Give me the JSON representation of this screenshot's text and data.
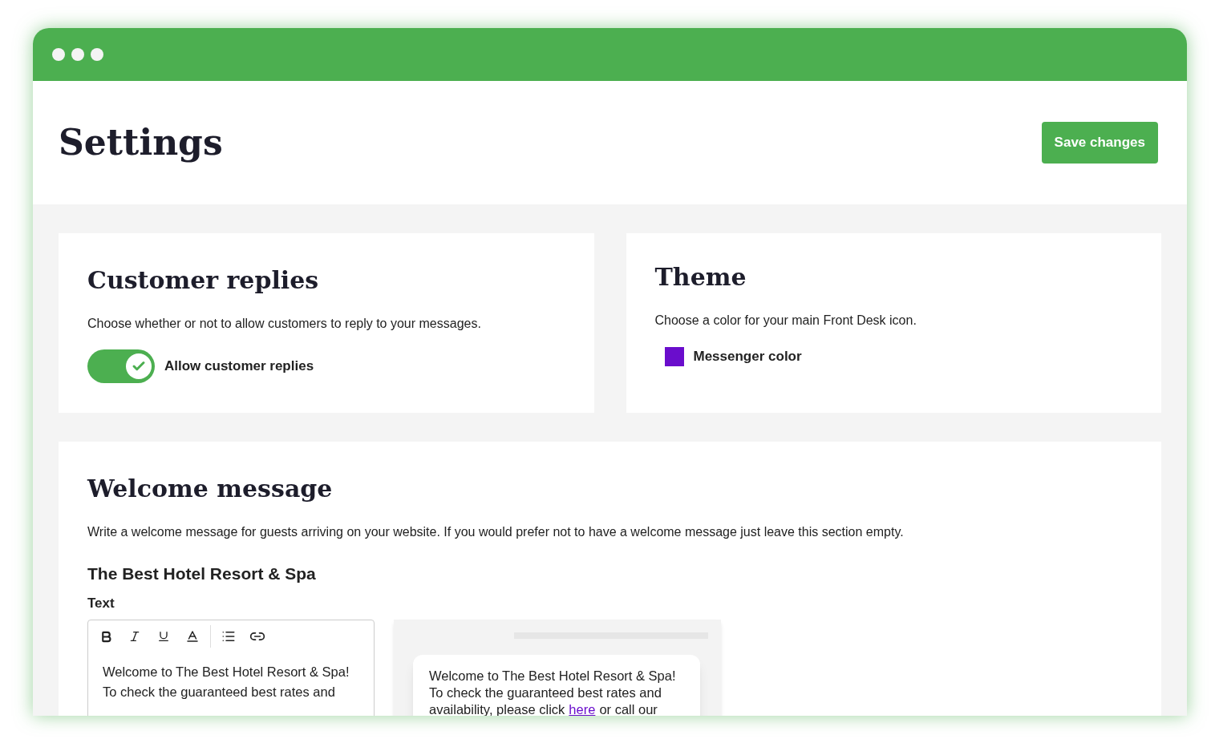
{
  "header": {
    "title": "Settings",
    "save_button": "Save changes"
  },
  "customer_replies": {
    "title": "Customer replies",
    "description": "Choose whether or not to allow customers to reply to your messages.",
    "toggle": {
      "label": "Allow customer replies",
      "on": true
    }
  },
  "theme": {
    "title": "Theme",
    "description": "Choose a color for your main Front Desk icon.",
    "swatch": {
      "label": "Messenger color",
      "color": "#6a0dcc"
    }
  },
  "welcome": {
    "title": "Welcome message",
    "description": "Write a welcome message for guests arriving on your website. If you would prefer not to have a welcome message just leave this section empty.",
    "hotel_name": "The Best Hotel Resort & Spa",
    "field_label": "Text",
    "toolbar": [
      {
        "kind": "bold"
      },
      {
        "kind": "italic"
      },
      {
        "kind": "underline"
      },
      {
        "kind": "color"
      },
      {
        "kind": "divider"
      },
      {
        "kind": "list"
      },
      {
        "kind": "link"
      }
    ],
    "editor_lines": [
      "Welcome to The Best Hotel Resort & Spa!",
      "To check the guaranteed best rates and"
    ],
    "preview": {
      "lines": [
        "Welcome to The Best Hotel Resort & Spa!",
        "To check the guaranteed best rates and"
      ],
      "last_line_before": "availability, please click",
      "link": "here",
      "last_line_after": "or call our"
    }
  }
}
